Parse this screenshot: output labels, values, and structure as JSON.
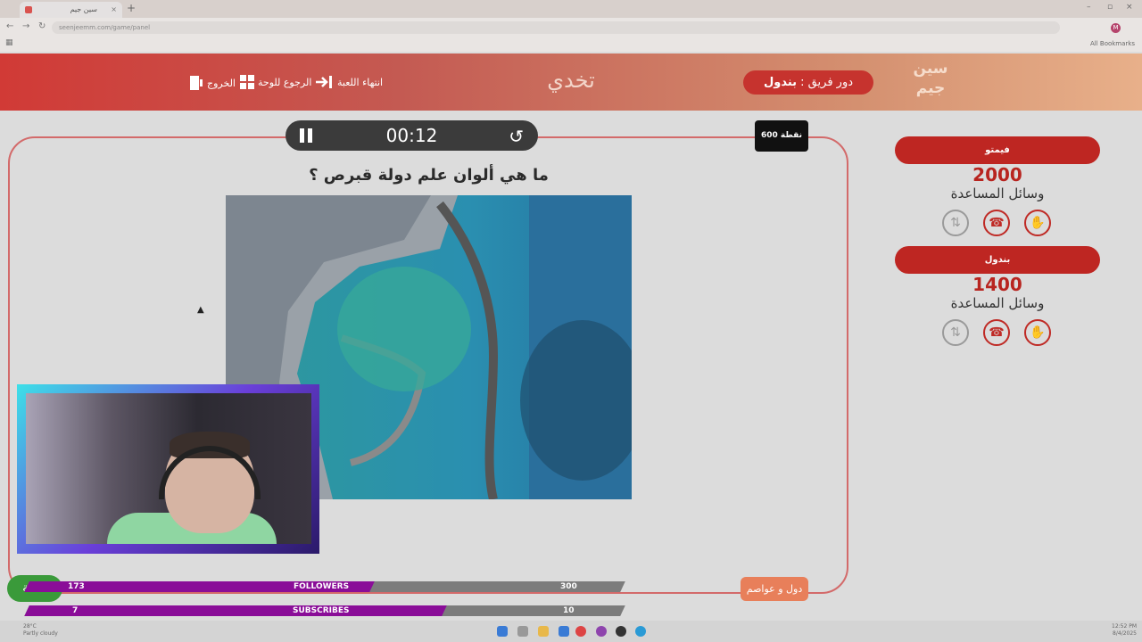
{
  "browser": {
    "tab_title": "سين جيم",
    "tab_close": "×",
    "new_tab": "+",
    "url": "seenjeemm.com/game/panel",
    "all_bookmarks": "All Bookmarks",
    "profile_initial": "M",
    "win_min": "–",
    "win_max": "▫",
    "win_close": "×"
  },
  "header": {
    "logo_text_1": "سين",
    "logo_text_2": "جيم",
    "turn_label": "دور فريق :",
    "turn_team": "بندول",
    "title": "تخدي",
    "end_game": "انتهاء اللعبة",
    "back_to_board": "الرجوع للوحة",
    "exit": "الخروج"
  },
  "question": {
    "timer": "00:12",
    "points": "600 نقطة",
    "text": "ما هي ألوان علم دولة قبرص ؟",
    "category": "دول و عواصم"
  },
  "teams": [
    {
      "name": "فيمتو",
      "score": "2000",
      "aids_label": "وسائل المساعدة"
    },
    {
      "name": "بندول",
      "score": "1400",
      "aids_label": "وسائل المساعدة"
    }
  ],
  "stream": {
    "followers": {
      "current": "173",
      "label": "FOLLOWERS",
      "goal": "300",
      "fraction": 0.58
    },
    "subscribes": {
      "current": "7",
      "label": "SUBSCRIBES",
      "goal": "10",
      "fraction": 0.7
    },
    "green_button": "نقطة"
  },
  "taskbar": {
    "weather_temp": "28°C",
    "weather_desc": "Partly cloudy",
    "time": "12:52 PM",
    "date": "8/4/2025"
  },
  "colors": {
    "brand_red": "#be2622",
    "header_grad_end": "#e8b08a",
    "bar_fill": "#8a0d98"
  }
}
